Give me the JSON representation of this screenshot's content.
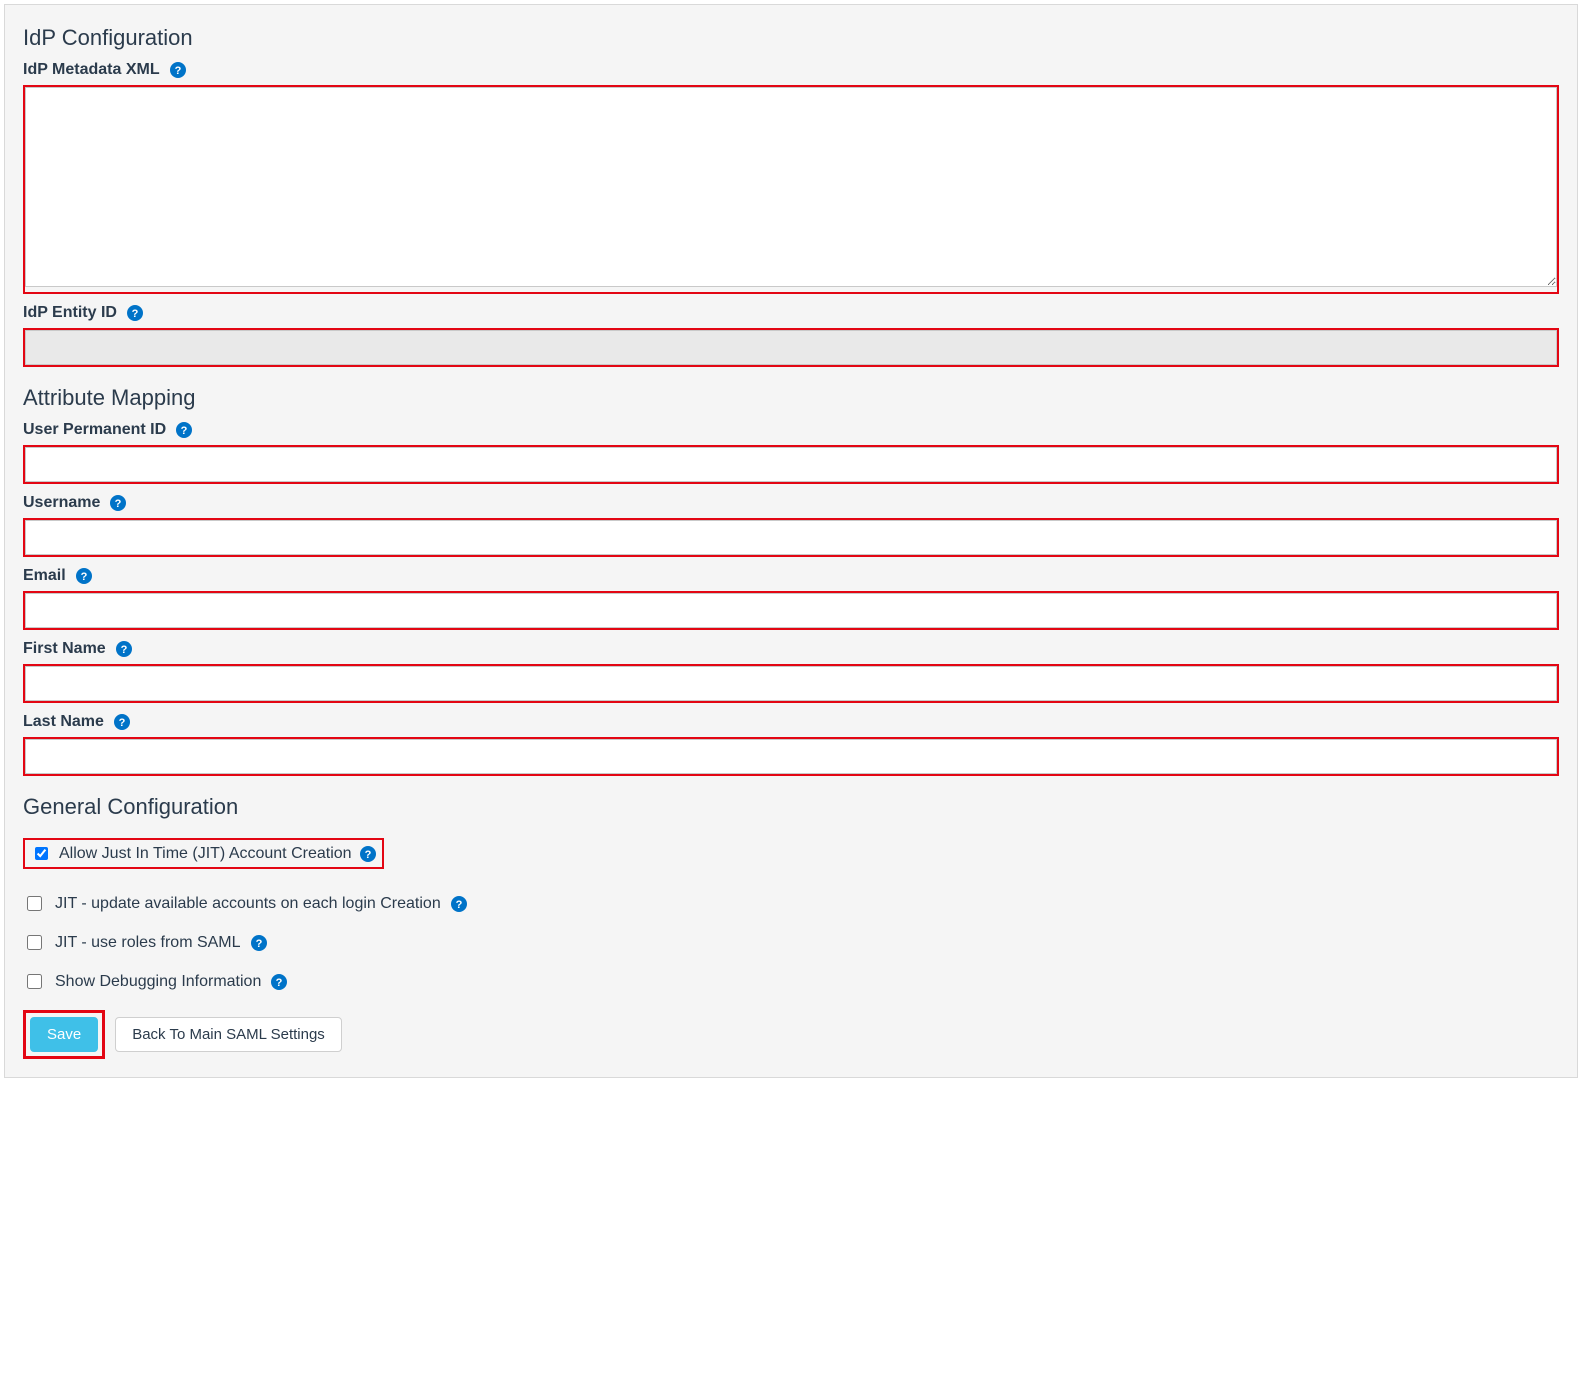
{
  "sections": {
    "idp": {
      "title": "IdP Configuration",
      "metadata_label": "IdP Metadata XML",
      "metadata_value": "",
      "entity_id_label": "IdP Entity ID",
      "entity_id_value": ""
    },
    "attr": {
      "title": "Attribute Mapping",
      "user_permanent_id_label": "User Permanent ID",
      "user_permanent_id_value": "",
      "username_label": "Username",
      "username_value": "",
      "email_label": "Email",
      "email_value": "",
      "first_name_label": "First Name",
      "first_name_value": "",
      "last_name_label": "Last Name",
      "last_name_value": ""
    },
    "general": {
      "title": "General Configuration",
      "jit_create_label": "Allow Just In Time (JIT) Account Creation",
      "jit_update_label": "JIT - update available accounts on each login Creation",
      "jit_roles_label": "JIT - use roles from SAML",
      "show_debug_label": "Show Debugging Information"
    }
  },
  "buttons": {
    "save": "Save",
    "back": "Back To Main SAML Settings"
  },
  "colors": {
    "highlight": "#e30613",
    "primary_btn": "#3fc0e8",
    "help_icon": "#0073c8"
  }
}
